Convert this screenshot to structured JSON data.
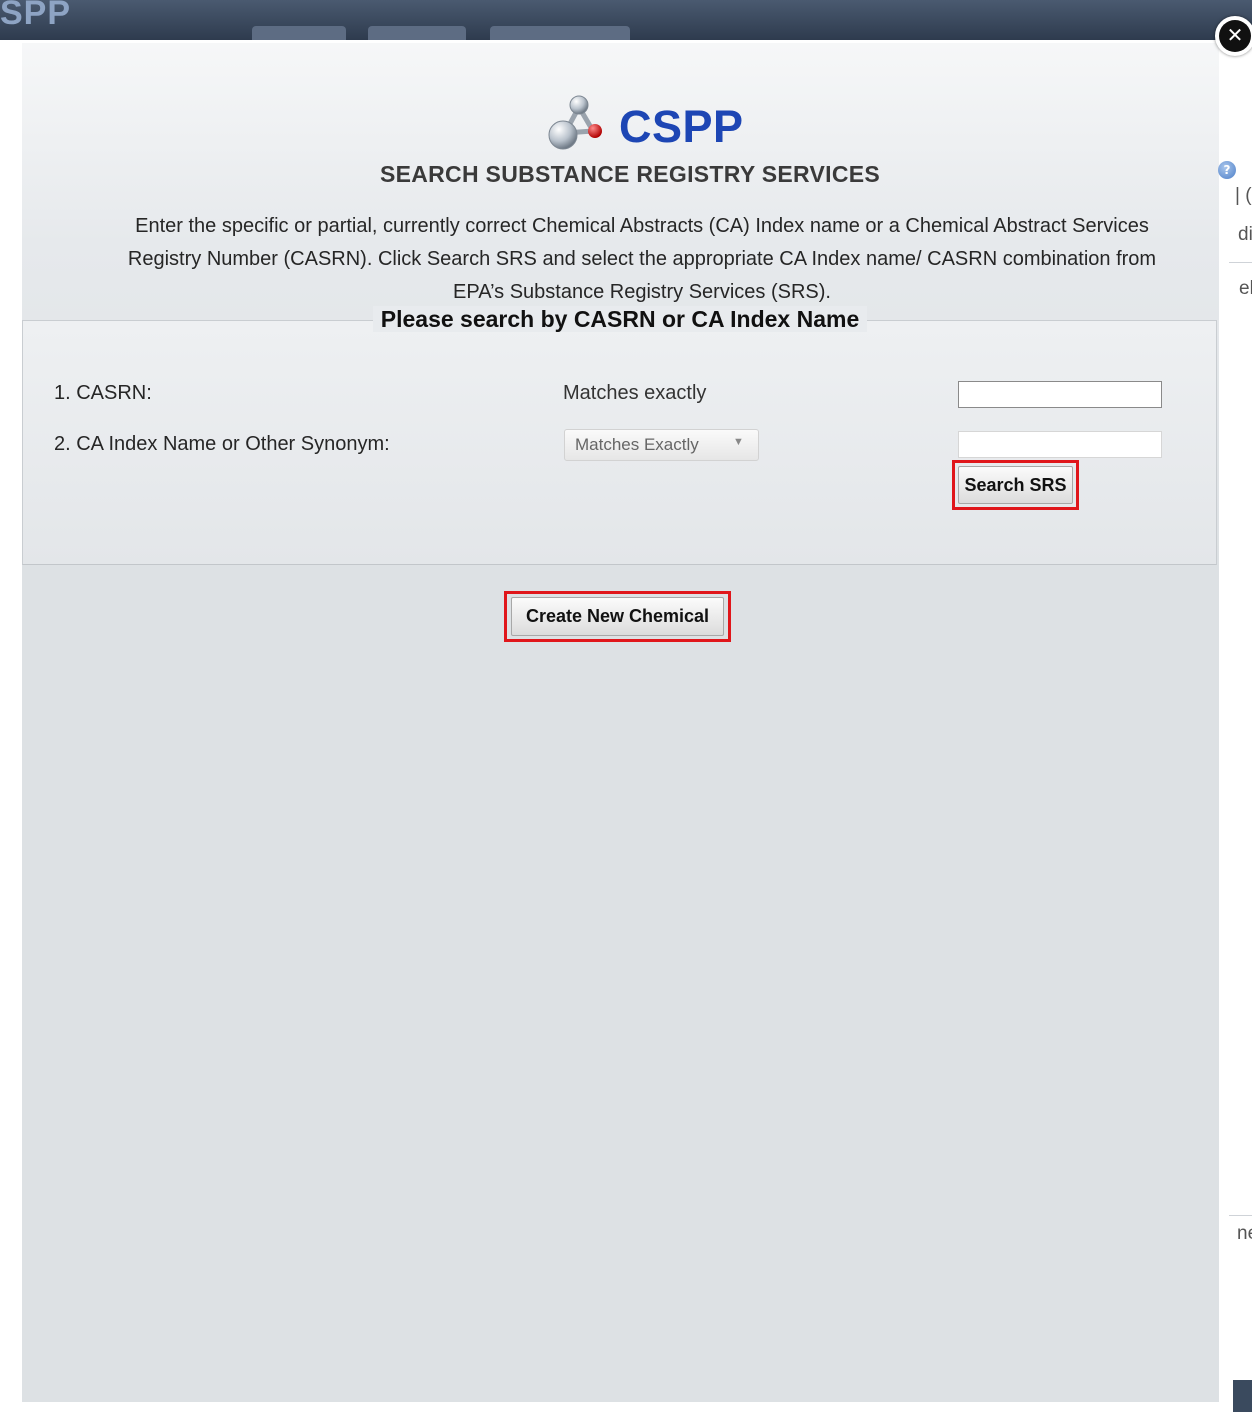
{
  "background": {
    "app_logo": "SPP",
    "edge_fragments": [
      "| (",
      "di",
      "el",
      "ne"
    ]
  },
  "modal": {
    "close_icon": "close-circle-icon",
    "brand": {
      "logo_icon": "molecule-icon",
      "name": "CSPP"
    },
    "title": "SEARCH SUBSTANCE REGISTRY SERVICES",
    "help_icon": "help-question-icon",
    "instructions": [
      "Enter the specific or partial, currently correct Chemical Abstracts (CA) Index name or a Chemical Abstract Services",
      "Registry Number (CASRN). Click Search SRS and select the appropriate CA Index name/ CASRN combination from",
      "EPA’s Substance Registry Services (SRS)."
    ],
    "search": {
      "legend": "Please search by CASRN or CA Index Name",
      "casrn": {
        "label": "1. CASRN:",
        "match_text": "Matches exactly",
        "value": ""
      },
      "ca_index": {
        "label": "2. CA Index Name or Other Synonym:",
        "match_select": "Matches Exactly",
        "value": ""
      },
      "search_button": "Search SRS"
    },
    "create_button": "Create New Chemical",
    "highlight_color": "#e0161b",
    "brand_color": "#1d46b4"
  }
}
